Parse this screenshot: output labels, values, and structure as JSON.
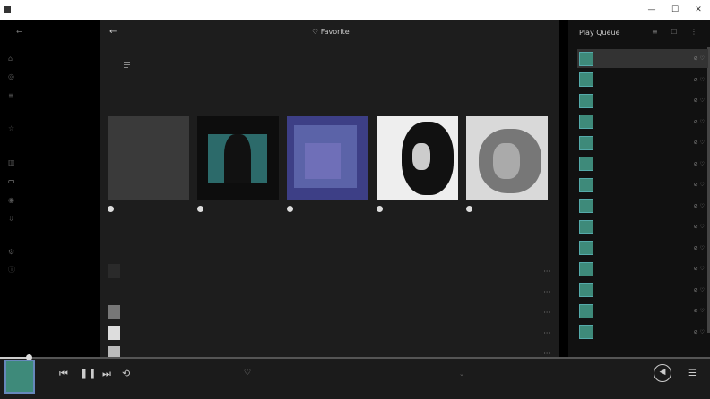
{
  "titlebar": {
    "buttons": {
      "minimize": "—",
      "maximize": "☐",
      "close": "✕"
    }
  },
  "sidebar": {
    "items": [
      {
        "icon": "home-icon",
        "glyph": "⌂",
        "active": false
      },
      {
        "icon": "radio-icon",
        "glyph": "◎",
        "active": false
      },
      {
        "icon": "list-icon",
        "glyph": "≡",
        "active": false
      },
      {
        "icon": "star-icon",
        "glyph": "☆",
        "active": false
      },
      {
        "icon": "stats-icon",
        "glyph": "▥",
        "active": false
      },
      {
        "icon": "folder-icon",
        "glyph": "▭",
        "active": true
      },
      {
        "icon": "globe-icon",
        "glyph": "◉",
        "active": false
      },
      {
        "icon": "download-icon",
        "glyph": "⇩",
        "active": false
      },
      {
        "icon": "settings-icon",
        "glyph": "⚙",
        "active": false
      },
      {
        "icon": "info-icon",
        "glyph": "ⓘ",
        "active": false
      }
    ]
  },
  "main": {
    "header": {
      "back": "←",
      "tab_favorites": "♡ Favorite"
    },
    "albums": [
      {
        "play": "▶"
      },
      {
        "play": "▶"
      },
      {
        "play": "▶"
      },
      {
        "play": "▶"
      },
      {
        "play": "▶"
      }
    ],
    "artists": [
      {
        "more": "···"
      },
      {
        "more": "···"
      },
      {
        "more": "···"
      },
      {
        "more": "···"
      },
      {
        "more": "···"
      }
    ]
  },
  "queue": {
    "title": "Play Queue",
    "header_icons": "≡ ☐ ⋮",
    "items": [
      {
        "active": true,
        "acts": "⊘ ♡"
      },
      {
        "active": false,
        "acts": "⊘ ♡"
      },
      {
        "active": false,
        "acts": "⊘ ♡"
      },
      {
        "active": false,
        "acts": "⊘ ♡"
      },
      {
        "active": false,
        "acts": "⊘ ♡"
      },
      {
        "active": false,
        "acts": "⊘ ♡"
      },
      {
        "active": false,
        "acts": "⊘ ♡"
      },
      {
        "active": false,
        "acts": "⊘ ♡"
      },
      {
        "active": false,
        "acts": "⊘ ♡"
      },
      {
        "active": false,
        "acts": "⊘ ♡"
      },
      {
        "active": false,
        "acts": "⊘ ♡"
      },
      {
        "active": false,
        "acts": "⊘ ♡"
      },
      {
        "active": false,
        "acts": "⊘ ♡"
      },
      {
        "active": false,
        "acts": "⊘ ♡"
      }
    ]
  },
  "player": {
    "progress": 0.04,
    "controls": {
      "prev": "⏮",
      "pause": "❚❚",
      "next": "⏭",
      "repeat": "⟲"
    },
    "favorite": "♡",
    "expand": "⌄",
    "volume_glyph": "◀",
    "menu_glyph": "☰"
  },
  "colors": {
    "background": "#1d1d1d",
    "sidebar": "#000000",
    "queue": "#111111",
    "accent": "#3e8a7a"
  }
}
